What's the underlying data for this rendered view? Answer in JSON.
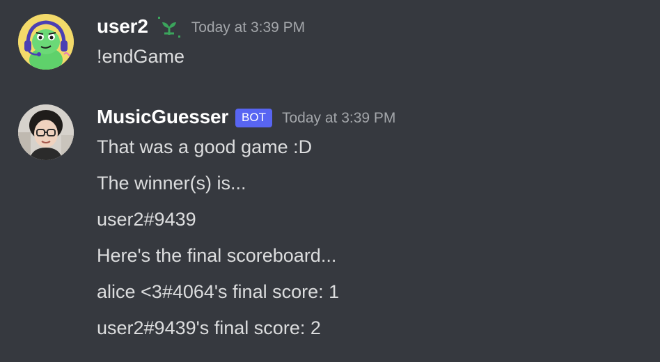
{
  "messages": [
    {
      "username": "user2",
      "timestamp": "Today at 3:39 PM",
      "badge_icon": "sprout-icon",
      "lines": [
        "!endGame"
      ]
    },
    {
      "username": "MusicGuesser",
      "bot_tag": "BOT",
      "timestamp": "Today at 3:39 PM",
      "lines": [
        "That was a good game :D",
        "The winner(s) is...",
        "user2#9439",
        "Here's the final scoreboard...",
        "alice <3#4064's final score: 1",
        "user2#9439's final score: 2"
      ]
    }
  ],
  "colors": {
    "background": "#36393f",
    "username": "#ffffff",
    "timestamp": "#a3a6aa",
    "message_text": "#dcddde",
    "bot_tag": "#5865f2",
    "sprout": "#3ba55c"
  }
}
